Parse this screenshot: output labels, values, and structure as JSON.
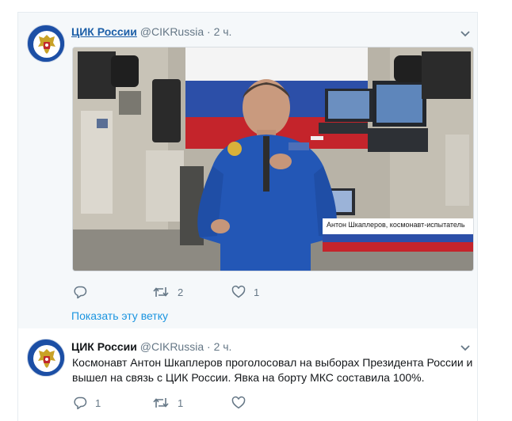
{
  "tweet1": {
    "author_name": "ЦИК России",
    "handle": "@CIKRussia",
    "separator": "·",
    "time": "2 ч.",
    "video_caption": "Антон Шкаплеров, космонавт-испытатель",
    "actions": {
      "reply_count": "",
      "retweet_count": "2",
      "like_count": "1"
    },
    "thread_link": "Показать эту ветку"
  },
  "tweet2": {
    "author_name": "ЦИК России",
    "handle": "@CIKRussia",
    "separator": "·",
    "time": "2 ч.",
    "text": "Космонавт Антон Шкаплеров проголосовал на выборах Президента России и вышел на связь с ЦИК России. Явка на борту МКС составила 100%.",
    "actions": {
      "reply_count": "1",
      "retweet_count": "1",
      "like_count": ""
    }
  },
  "colors": {
    "link_blue": "#1b95e0",
    "secondary_text": "#657786",
    "border": "#e6ecf0",
    "thread_bg": "#f5f8fa"
  },
  "icons": [
    "emblem-avatar-icon",
    "chevron-down-icon",
    "reply-icon",
    "retweet-icon",
    "like-icon"
  ]
}
